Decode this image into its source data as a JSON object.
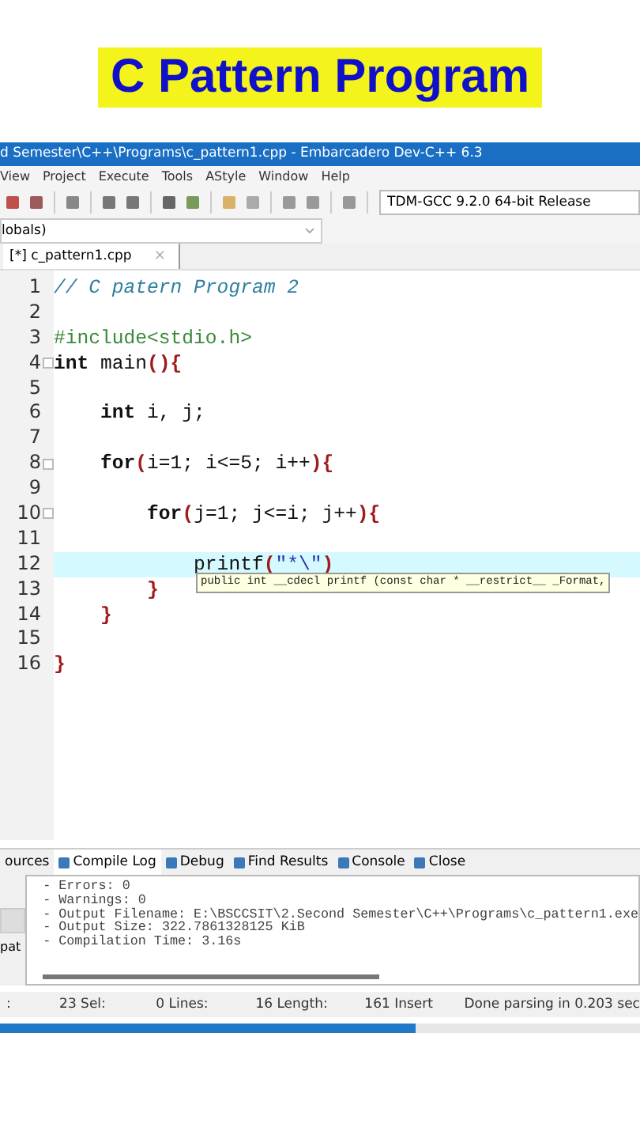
{
  "banner": {
    "title": "C Pattern Program"
  },
  "window": {
    "title": "d Semester\\C++\\Programs\\c_pattern1.cpp - Embarcadero Dev-C++ 6.3"
  },
  "menu": [
    "View",
    "Project",
    "Execute",
    "Tools",
    "AStyle",
    "Window",
    "Help"
  ],
  "toolbar": {
    "compiler": "TDM-GCC 9.2.0 64-bit Release"
  },
  "scope": {
    "value": "lobals)"
  },
  "tabs": [
    {
      "label": "[*] c_pattern1.cpp",
      "close": "×",
      "selected": true
    }
  ],
  "editor": {
    "lines": [
      {
        "number": "1",
        "fold": false,
        "current": false,
        "tokens": [
          {
            "kind": "comment",
            "text": "// C patern Program 2"
          }
        ]
      },
      {
        "number": "2",
        "fold": false,
        "current": false
      },
      {
        "number": "3",
        "fold": false,
        "current": false,
        "tokens": [
          {
            "kind": "preproc",
            "text": "#include<stdio.h>"
          }
        ]
      },
      {
        "number": "4",
        "fold": true,
        "current": false,
        "tokens": [
          {
            "kind": "keyword",
            "text": "int"
          },
          {
            "kind": "plain",
            "text": " main"
          },
          {
            "kind": "symbol",
            "text": "(){"
          }
        ]
      },
      {
        "number": "5",
        "fold": false,
        "current": false
      },
      {
        "number": "6",
        "fold": false,
        "current": false,
        "tokens": [
          {
            "kind": "keyword",
            "text": "    int"
          },
          {
            "kind": "plain",
            "text": " i, j;"
          }
        ]
      },
      {
        "number": "7",
        "fold": false,
        "current": false
      },
      {
        "number": "8",
        "fold": true,
        "current": false,
        "tokens": [
          {
            "kind": "keyword",
            "text": "    for"
          },
          {
            "kind": "symbol",
            "text": "("
          },
          {
            "kind": "plain",
            "text": "i=1; i<=5; i++"
          },
          {
            "kind": "symbol",
            "text": "){"
          }
        ]
      },
      {
        "number": "9",
        "fold": false,
        "current": false
      },
      {
        "number": "10",
        "fold": true,
        "current": false,
        "tokens": [
          {
            "kind": "keyword",
            "text": "        for"
          },
          {
            "kind": "symbol",
            "text": "("
          },
          {
            "kind": "plain",
            "text": "j=1; j<=i; j++"
          },
          {
            "kind": "symbol",
            "text": "){"
          }
        ]
      },
      {
        "number": "11",
        "fold": false,
        "current": false
      },
      {
        "number": "12",
        "fold": false,
        "current": true,
        "tokens": [
          {
            "kind": "plain",
            "text": "            printf"
          },
          {
            "kind": "symbol",
            "text": "("
          },
          {
            "kind": "string",
            "text": "\"*\\\""
          },
          {
            "kind": "symbol",
            "text": ")"
          }
        ]
      },
      {
        "number": "13",
        "fold": false,
        "current": false,
        "tokens": [
          {
            "kind": "symbol",
            "text": "        }"
          }
        ]
      },
      {
        "number": "14",
        "fold": false,
        "current": false,
        "tokens": [
          {
            "kind": "symbol",
            "text": "    }"
          }
        ]
      },
      {
        "number": "15",
        "fold": false,
        "current": false
      },
      {
        "number": "16",
        "fold": false,
        "current": false,
        "tokens": [
          {
            "kind": "symbol",
            "text": "}"
          }
        ]
      }
    ],
    "tooltip": "public int __cdecl printf (const char * __restrict__ _Format,"
  },
  "bottom_tabs": [
    {
      "label": "ources",
      "selected": false
    },
    {
      "label": "Compile Log",
      "selected": true
    },
    {
      "label": "Debug",
      "selected": false
    },
    {
      "label": "Find Results",
      "selected": false
    },
    {
      "label": "Console",
      "selected": false
    },
    {
      "label": "Close",
      "selected": false
    }
  ],
  "side_label": "pat",
  "compile_log": [
    "- Errors: 0",
    "- Warnings: 0",
    "- Output Filename: E:\\BSCCSIT\\2.Second Semester\\C++\\Programs\\c_pattern1.exe",
    "- Output Size: 322.7861328125 KiB",
    "- Compilation Time: 3.16s"
  ],
  "status_bar": [
    ":",
    "23 Sel:",
    "0 Lines:",
    "16 Length:",
    "161 Insert",
    "Done parsing in 0.203 sec"
  ],
  "progress": {
    "level": 0.65
  }
}
